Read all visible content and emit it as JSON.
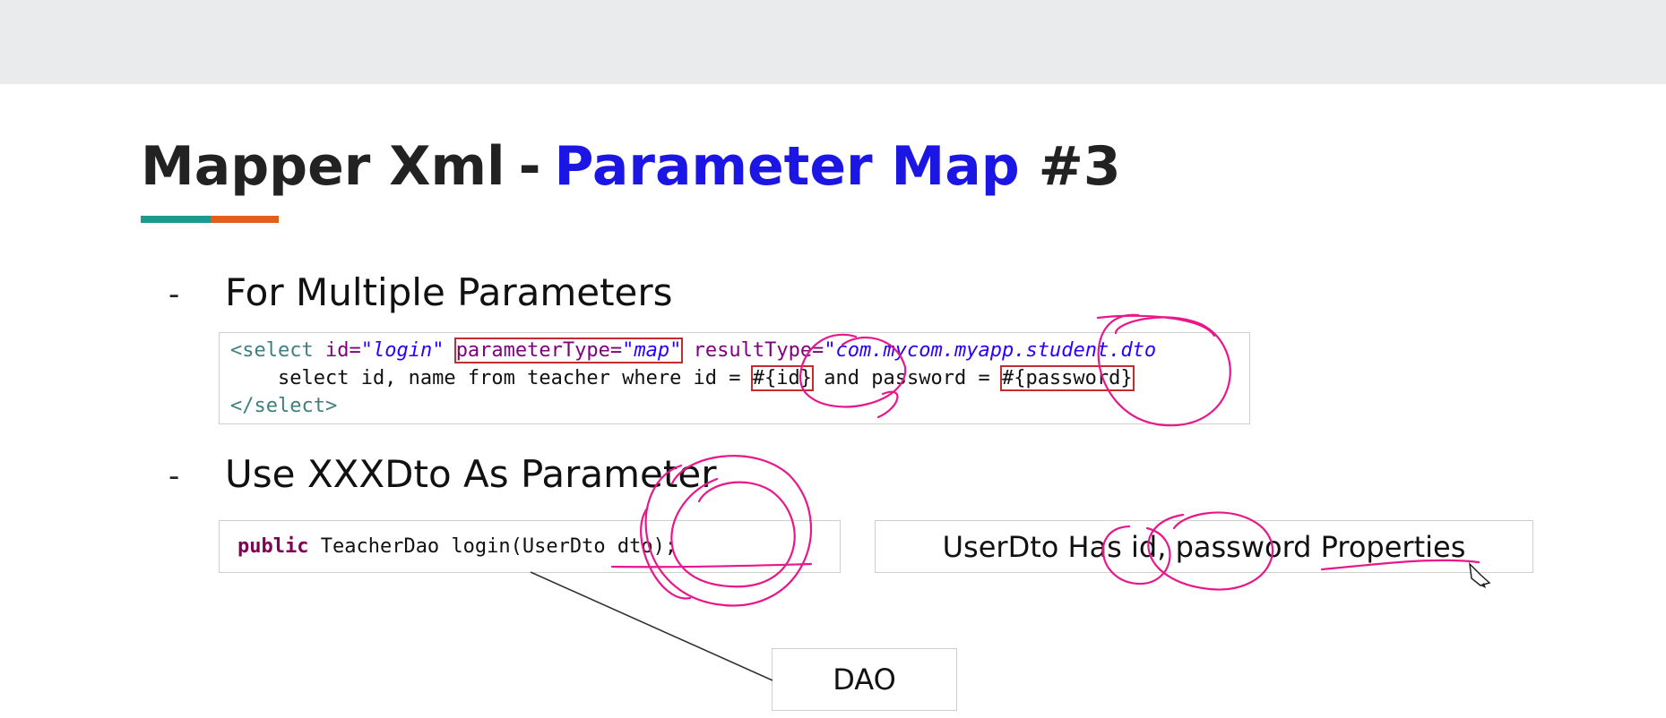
{
  "slide": {
    "title_part1": "Mapper Xml",
    "title_separator": "-",
    "title_part2": "Parameter Map",
    "title_part3": "#3"
  },
  "bullets": [
    {
      "dash": "-",
      "text": "For Multiple Parameters"
    },
    {
      "dash": "-",
      "text": "Use XXXDto As Parameter"
    }
  ],
  "code_block_1": {
    "lines": [
      {
        "open": "<select ",
        "id_attr": "id=",
        "id_val": "\"login\"",
        "ptype_attr": "parameterType=",
        "ptype_val": "\"map\"",
        "rtype_attr": "resultType=",
        "rtype_val": "\"com.mycom.myapp.student.dto"
      },
      {
        "before_id": "    select id, name from teacher where id = ",
        "id_param": "#{id}",
        "middle": " and password = ",
        "pw_param": "#{password}"
      },
      {
        "close": "</select>"
      }
    ]
  },
  "code_block_2": {
    "keyword": "public",
    "rest_before": " TeacherDao login(",
    "param": "UserDto dto",
    "rest_after": ");"
  },
  "note_box": {
    "text": "UserDto Has id, password Properties"
  },
  "dao_box": {
    "text": "DAO"
  },
  "colors": {
    "title_blue": "#1c16e4",
    "accent_teal": "#1c9a8f",
    "accent_orange": "#e25f1b",
    "highlight_red": "#c32d2d",
    "annotation_pink": "#e8178a"
  }
}
